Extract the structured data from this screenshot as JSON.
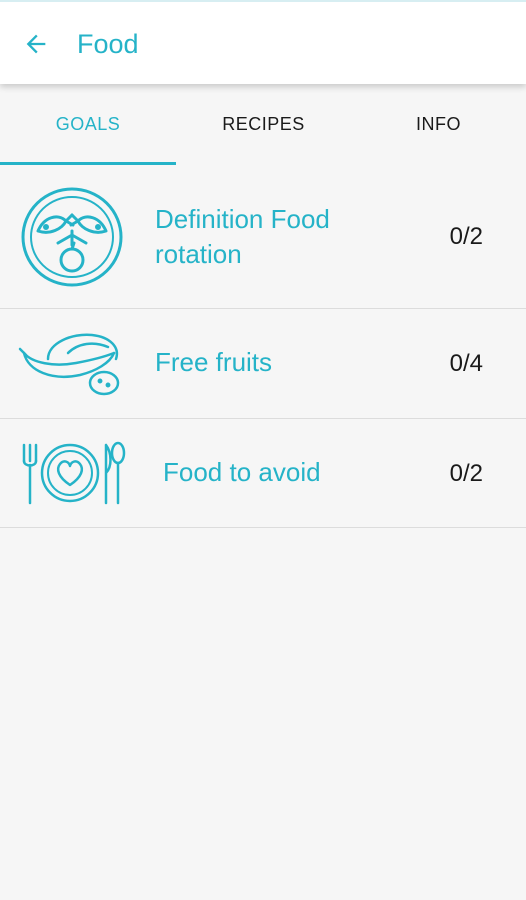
{
  "header": {
    "title": "Food",
    "back_icon": "arrow-left-icon"
  },
  "tabs": [
    {
      "label": "GOALS",
      "active": true
    },
    {
      "label": "RECIPES",
      "active": false
    },
    {
      "label": "INFO",
      "active": false
    }
  ],
  "goals": [
    {
      "label": "Definition Food rotation",
      "count": "0/2",
      "icon": "plate-fish-fruit-icon"
    },
    {
      "label": "Free fruits",
      "count": "0/4",
      "icon": "fruits-icon"
    },
    {
      "label": "Food to avoid",
      "count": "0/2",
      "icon": "plate-heart-cutlery-icon"
    }
  ],
  "colors": {
    "accent": "#25b3c8",
    "background": "#f6f6f6",
    "text": "#1a1a1a",
    "divider": "#dcdcdc"
  }
}
